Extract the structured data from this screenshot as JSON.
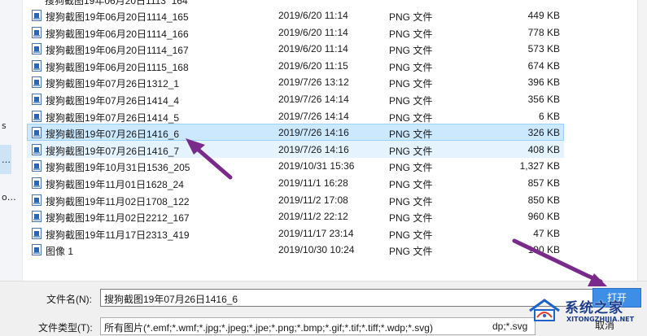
{
  "nav": {
    "glyphs": [
      "s",
      "…",
      "o…"
    ]
  },
  "files": [
    {
      "name": "搜狗截图19年06月20日1114_165",
      "date": "2019/6/20 11:14",
      "type": "PNG 文件",
      "size": "449 KB"
    },
    {
      "name": "搜狗截图19年06月20日1114_166",
      "date": "2019/6/20 11:14",
      "type": "PNG 文件",
      "size": "778 KB"
    },
    {
      "name": "搜狗截图19年06月20日1114_167",
      "date": "2019/6/20 11:14",
      "type": "PNG 文件",
      "size": "573 KB"
    },
    {
      "name": "搜狗截图19年06月20日1115_168",
      "date": "2019/6/20 11:15",
      "type": "PNG 文件",
      "size": "674 KB"
    },
    {
      "name": "搜狗截图19年07月26日1312_1",
      "date": "2019/7/26 13:12",
      "type": "PNG 文件",
      "size": "396 KB"
    },
    {
      "name": "搜狗截图19年07月26日1414_4",
      "date": "2019/7/26 14:14",
      "type": "PNG 文件",
      "size": "356 KB"
    },
    {
      "name": "搜狗截图19年07月26日1414_5",
      "date": "2019/7/26 14:14",
      "type": "PNG 文件",
      "size": "6 KB"
    },
    {
      "name": "搜狗截图19年07月26日1416_6",
      "date": "2019/7/26 14:16",
      "type": "PNG 文件",
      "size": "326 KB"
    },
    {
      "name": "搜狗截图19年07月26日1416_7",
      "date": "2019/7/26 14:16",
      "type": "PNG 文件",
      "size": "408 KB"
    },
    {
      "name": "搜狗截图19年10月31日1536_205",
      "date": "2019/10/31 15:36",
      "type": "PNG 文件",
      "size": "1,327 KB"
    },
    {
      "name": "搜狗截图19年11月01日1628_24",
      "date": "2019/11/1 16:28",
      "type": "PNG 文件",
      "size": "857 KB"
    },
    {
      "name": "搜狗截图19年11月02日1708_122",
      "date": "2019/11/2 17:08",
      "type": "PNG 文件",
      "size": "850 KB"
    },
    {
      "name": "搜狗截图19年11月02日2212_167",
      "date": "2019/11/2 22:12",
      "type": "PNG 文件",
      "size": "960 KB"
    },
    {
      "name": "搜狗截图19年11月17日2313_419",
      "date": "2019/11/17 23:14",
      "type": "PNG 文件",
      "size": "47 KB"
    },
    {
      "name": "图像 1",
      "date": "2019/10/30 10:24",
      "type": "PNG 文件",
      "size": "190 KB"
    }
  ],
  "selected_index": 7,
  "hover_index": 8,
  "bottom": {
    "filename_label": "文件名(N):",
    "filename_value": "搜狗截图19年07月26日1416_6",
    "filetype_label": "文件类型(T):",
    "filetype_value": "所有图片(*.emf;*.wmf;*.jpg;*.jpeg;*.jpe;*.png;*.bmp;*.gif;*.tif;*.tiff;*.wdp;*.svg)",
    "filetype_tail": "dp;*.svg",
    "open_label": "打开",
    "cancel_label": "取消"
  },
  "watermark": {
    "text": "系统之家",
    "url": "XITONGZHIJIA.NET"
  },
  "colors": {
    "selected_bg": "#cce8ff",
    "hover_bg": "#e5f3ff",
    "accent_button": "#3d8ee6",
    "arrow": "#7a2a8a"
  }
}
